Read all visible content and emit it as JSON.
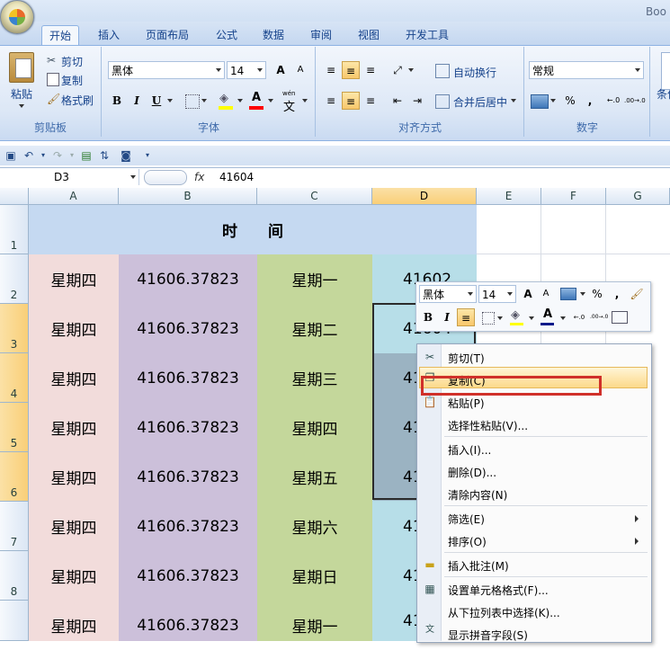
{
  "app": {
    "title_fragment": "Boo"
  },
  "tabs": [
    "开始",
    "插入",
    "页面布局",
    "公式",
    "数据",
    "审阅",
    "视图",
    "开发工具"
  ],
  "ribbon": {
    "clipboard": {
      "paste": "粘贴",
      "cut": "剪切",
      "copy": "复制",
      "format_painter": "格式刷",
      "label": "剪贴板"
    },
    "font": {
      "name": "黑体",
      "size": "14",
      "label": "字体",
      "bold": "B",
      "italic": "I",
      "underline": "U",
      "grow": "A",
      "shrink": "A",
      "color_letter": "A",
      "wen": "wén",
      "wen_char": "文"
    },
    "alignment": {
      "wrap": "自动换行",
      "merge": "合并后居中",
      "label": "对齐方式"
    },
    "number": {
      "format": "常规",
      "label": "数字",
      "percent": "%",
      "comma": ",",
      "inc": "←.0",
      "dec": ".00→.0"
    },
    "styles_fragment": "条件"
  },
  "formula_bar": {
    "cell_ref": "D3",
    "fx": "fx",
    "value": "41604"
  },
  "columns": [
    "A",
    "B",
    "C",
    "D",
    "E",
    "F",
    "G"
  ],
  "rows": [
    "1",
    "2",
    "3",
    "4",
    "5",
    "6",
    "7",
    "8",
    ""
  ],
  "sheet": {
    "header": "时　　间",
    "col_a": [
      "星期四",
      "星期四",
      "星期四",
      "星期四",
      "星期四",
      "星期四",
      "星期四",
      "星期四"
    ],
    "col_b": [
      "41606.37823",
      "41606.37823",
      "41606.37823",
      "41606.37823",
      "41606.37823",
      "41606.37823",
      "41606.37823",
      "41606.37823"
    ],
    "col_c": [
      "星期一",
      "星期二",
      "星期三",
      "星期四",
      "星期五",
      "星期六",
      "星期日",
      "星期一"
    ],
    "col_d": [
      "41602",
      "41604",
      "41",
      "41",
      "41",
      "41",
      "41",
      "41"
    ]
  },
  "mini_toolbar": {
    "font": "黑体",
    "size": "14",
    "percent": "%",
    "comma": ","
  },
  "context_menu": {
    "items": [
      "剪切(T)",
      "复制(C)",
      "粘贴(P)",
      "选择性粘贴(V)...",
      "插入(I)...",
      "删除(D)...",
      "清除内容(N)",
      "筛选(E)",
      "排序(O)",
      "插入批注(M)",
      "设置单元格格式(F)...",
      "从下拉列表中选择(K)...",
      "显示拼音字段(S)"
    ]
  },
  "colors": {
    "col_a": "#f2dcdb",
    "col_b": "#ccc0da",
    "col_c": "#c4d79b",
    "col_d": "#b7dee8",
    "header": "#c5d9f1",
    "highlight_box": "#d0302a"
  }
}
